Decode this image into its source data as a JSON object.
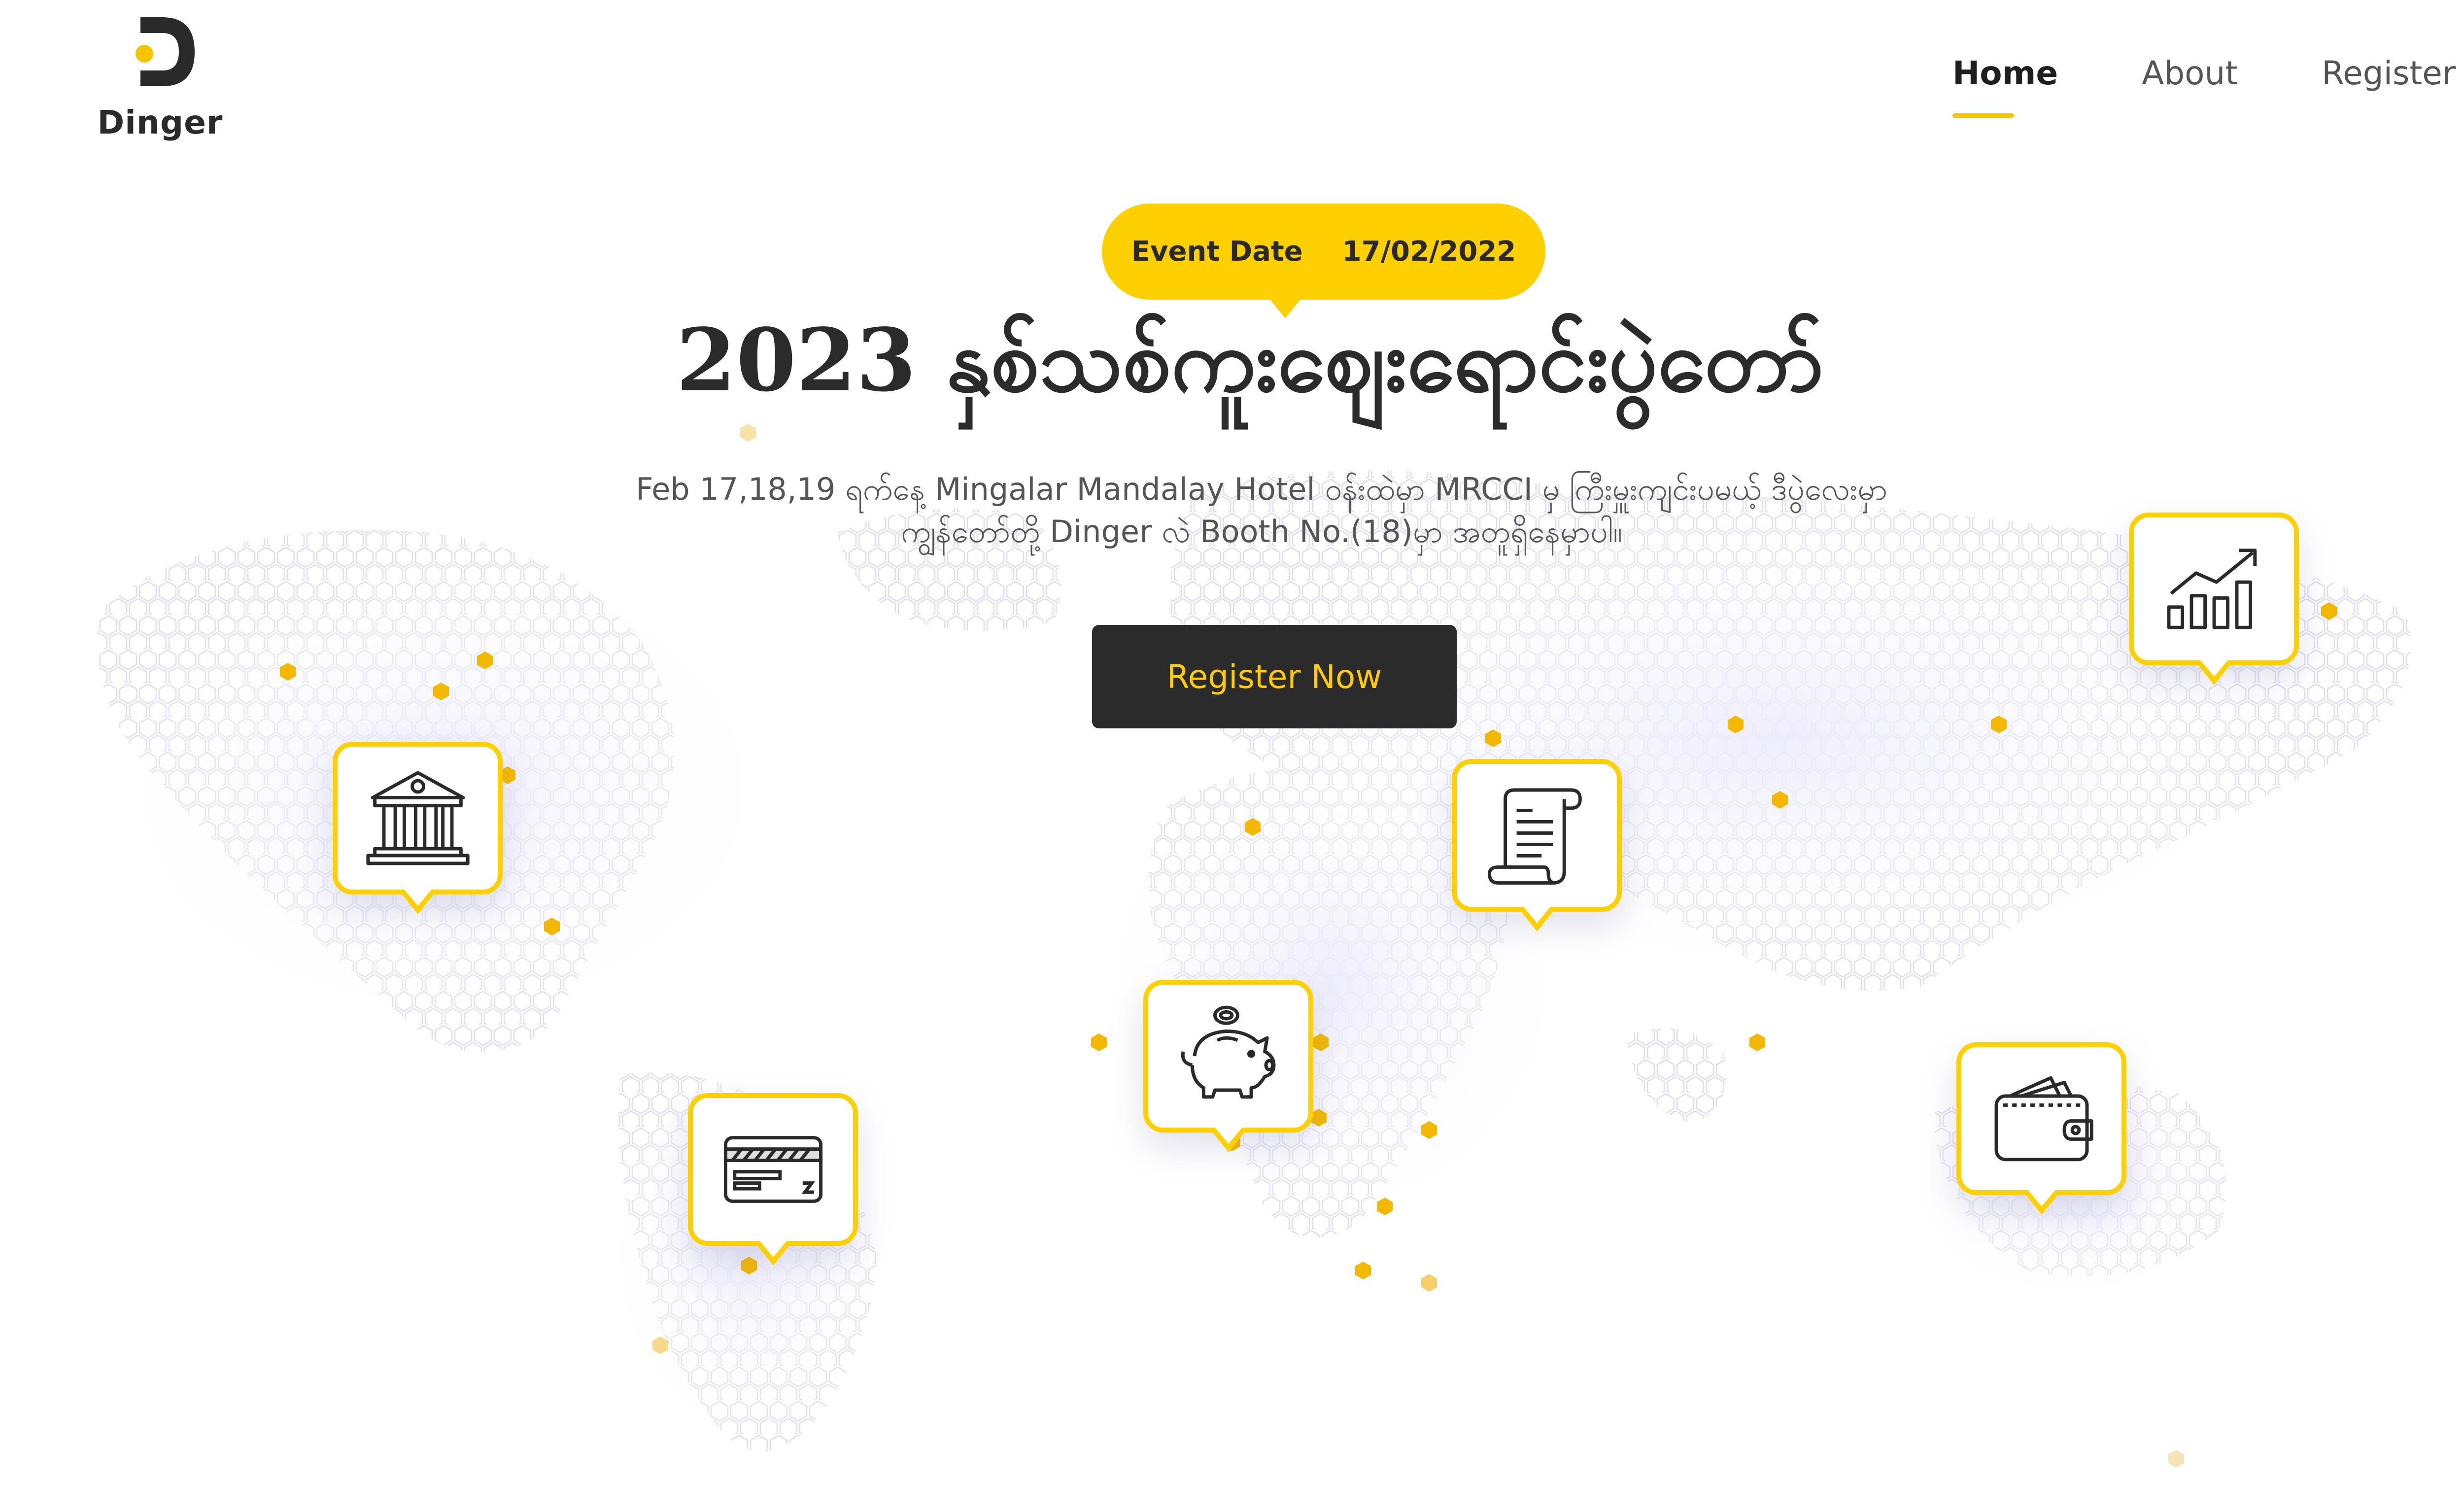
{
  "brand": {
    "name": "Dinger",
    "accent_color": "#ffd000",
    "dark_color": "#2b2b2b"
  },
  "nav": {
    "items": [
      {
        "label": "Home",
        "active": true
      },
      {
        "label": "About",
        "active": false
      },
      {
        "label": "Register",
        "active": false
      }
    ]
  },
  "hero": {
    "event_label": "Event Date",
    "event_date": "17/02/2022",
    "title": "2023 နှစ်သစ်ကူးဈေးရောင်းပွဲတော်",
    "description_line1": "Feb 17,18,19 ရက်နေ့ Mingalar Mandalay Hotel ဝန်းထဲမှာ MRCCI မှ ကြီးမှူးကျင်းပမယ့် ဒီပွဲလေးမှာ",
    "description_line2": "ကျွန်တော်တို့ Dinger လဲ Booth No.(18)မှာ အတူရှိနေမှာပါ။",
    "cta_label": "Register Now"
  },
  "map_markers": [
    {
      "icon": "bank-icon"
    },
    {
      "icon": "credit-card-icon"
    },
    {
      "icon": "piggy-bank-icon"
    },
    {
      "icon": "receipt-scroll-icon"
    },
    {
      "icon": "wallet-icon"
    },
    {
      "icon": "growth-chart-icon"
    }
  ]
}
